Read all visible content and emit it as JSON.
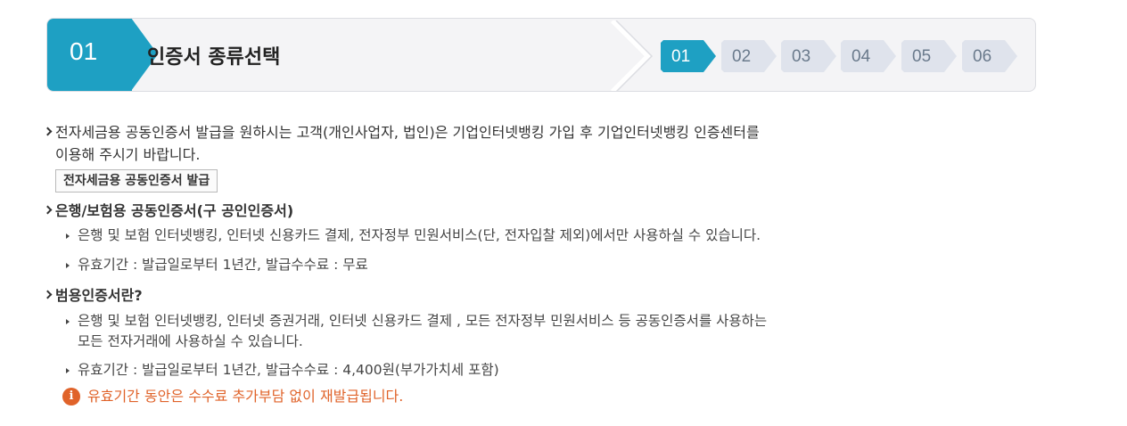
{
  "step_header": {
    "current_number": "01",
    "title": "인증서 종류선택",
    "steps": [
      {
        "label": "01",
        "active": true
      },
      {
        "label": "02",
        "active": false
      },
      {
        "label": "03",
        "active": false
      },
      {
        "label": "04",
        "active": false
      },
      {
        "label": "05",
        "active": false
      },
      {
        "label": "06",
        "active": false
      }
    ],
    "active_color": "#1ea0c3",
    "inactive_color": "#dfe3ec"
  },
  "intro": {
    "line1": "전자세금용 공동인증서 발급을 원하시는 고객(개인사업자, 법인)은 기업인터넷뱅킹 가입 후 기업인터넷뱅킹 인증센터를",
    "line2": "이용해 주시기 바랍니다.",
    "button_label": "전자세금용 공동인증서 발급"
  },
  "bank_cert": {
    "title": "은행/보험용 공동인증서(구 공인인증서)",
    "items": [
      "은행 및 보험 인터넷뱅킹, 인터넷 신용카드 결제, 전자정부 민원서비스(단, 전자입찰 제외)에서만 사용하실 수 있습니다.",
      "유효기간 : 발급일로부터 1년간, 발급수수료 : 무료"
    ]
  },
  "general_cert": {
    "title": "범용인증서란?",
    "item1_line1": "은행 및 보험 인터넷뱅킹, 인터넷 증권거래, 인터넷 신용카드 결제 , 모든 전자정부 민원서비스 등 공동인증서를 사용하는",
    "item1_line2": "모든 전자거래에 사용하실 수 있습니다.",
    "item2": "유효기간 : 발급일로부터 1년간, 발급수수료 : 4,400원(부가가치세 포함)"
  },
  "notice": {
    "icon": "info-icon",
    "text": "유효기간 동안은 수수료 추가부담 없이 재발급됩니다.",
    "color": "#e0632a"
  }
}
